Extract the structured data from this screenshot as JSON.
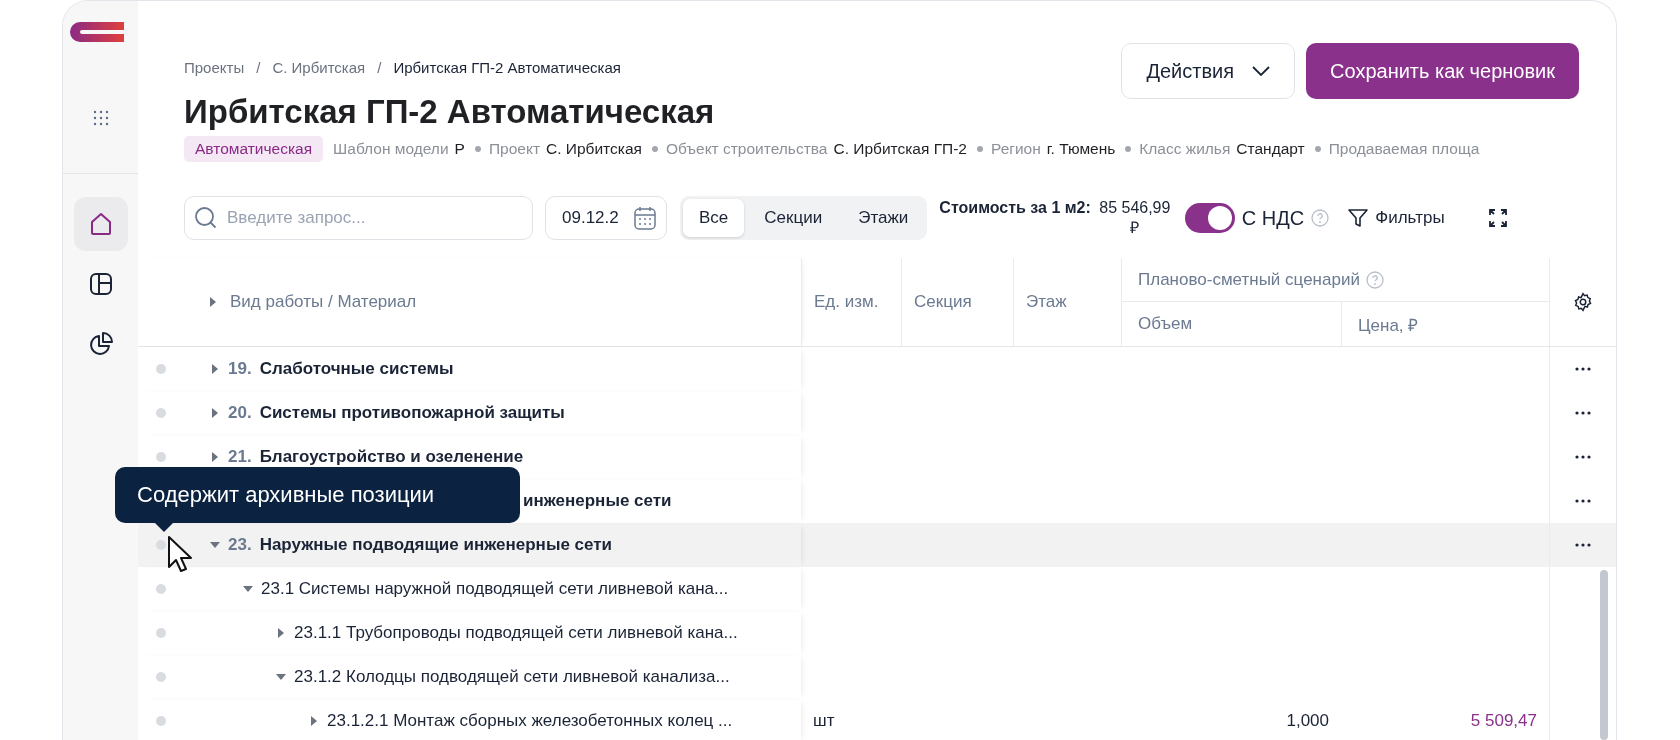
{
  "sidebar": {
    "items": [
      {
        "selected": true
      },
      {
        "selected": false
      },
      {
        "selected": false
      }
    ]
  },
  "breadcrumbs": {
    "separator": "/",
    "items": [
      "Проекты",
      "С. Ирбитская",
      "Ирбитская ГП-2 Автоматическая"
    ]
  },
  "header": {
    "title": "Ирбитская ГП-2 Автоматическая",
    "tag": "Автоматическая",
    "meta": [
      {
        "label": "Шаблон модели",
        "value": "Р"
      },
      {
        "label": "Проект",
        "value": "С. Ирбитская"
      },
      {
        "label": "Объект строительства",
        "value": "С. Ирбитская ГП-2"
      },
      {
        "label": "Регион",
        "value": "г. Тюмень"
      },
      {
        "label": "Класс жилья",
        "value": "Стандарт"
      },
      {
        "label": "Продаваемая площа"
      }
    ]
  },
  "actions": {
    "menu_button": "Действия",
    "primary_button": "Сохранить как черновик"
  },
  "toolbar": {
    "search": {
      "placeholder": "Введите запрос..."
    },
    "date": "09.12.2",
    "segments": [
      {
        "label": "Все",
        "selected": true
      },
      {
        "label": "Секции",
        "selected": false
      },
      {
        "label": "Этажи",
        "selected": false
      }
    ],
    "cost_label": "Стоимость за 1 м2:",
    "cost_value": "85 546,99 ₽",
    "vat": {
      "label": "С НДС",
      "on": true
    },
    "filters": "Фильтры"
  },
  "table": {
    "columns": {
      "name": "Вид работы / Материал",
      "unit": "Ед. изм.",
      "section": "Секция",
      "floor": "Этаж",
      "group": "Планово-сметный сценарий",
      "volume": "Объем",
      "price": "Цена, ₽"
    },
    "rows": [
      {
        "num": "19.",
        "title": "Слаботочные системы",
        "expanded": false,
        "highlighted": false
      },
      {
        "num": "20.",
        "title": "Системы противопожарной защиты",
        "expanded": false,
        "highlighted": false
      },
      {
        "num": "21.",
        "title": "Благоустройство и озеленение",
        "expanded": false,
        "highlighted": false
      },
      {
        "title": "инженерные сети",
        "highlighted": false
      },
      {
        "num": "23.",
        "title": "Наружные подводящие инженерные сети",
        "expanded": true,
        "highlighted": true,
        "children": [
          {
            "title": "23.1 Системы наружной подводящей сети ливневой кана...",
            "expanded": true,
            "highlighted": false,
            "children": [
              {
                "title": "23.1.1 Трубопроводы подводящей сети ливневой кана...",
                "expanded": false,
                "highlighted": false
              },
              {
                "title": "23.1.2 Колодцы подводящей сети ливневой канализа...",
                "expanded": true,
                "highlighted": false,
                "children": [
                  {
                    "title": "23.1.2.1 Монтаж сборных железобетонных колец ...",
                    "expanded": false,
                    "highlighted": false,
                    "unit": "шт",
                    "volume": "1,000",
                    "price": "5 509,47"
                  }
                ]
              }
            ]
          }
        ]
      }
    ]
  },
  "tooltip": "Содержит архивные позиции"
}
